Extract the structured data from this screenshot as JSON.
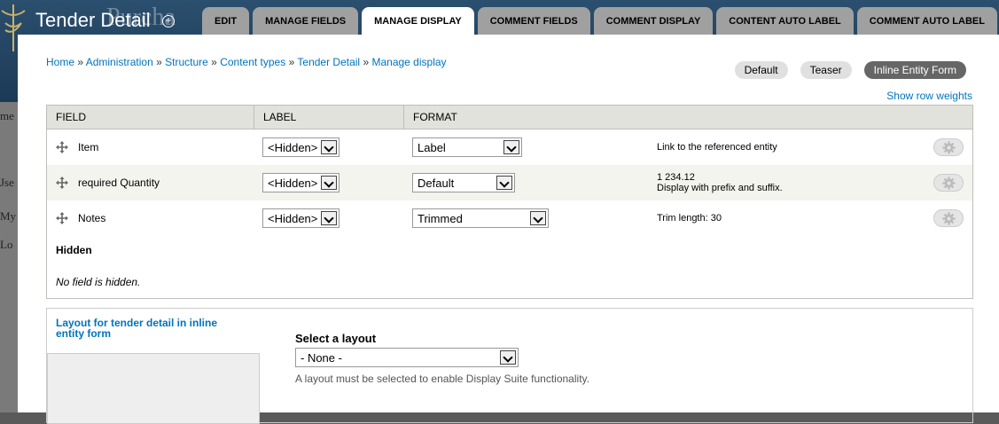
{
  "background": {
    "site_title_fragment": "Purcha",
    "left_texts": [
      "me",
      "Jse",
      "My",
      "Lo"
    ]
  },
  "overlay": {
    "title": "Tender Detail"
  },
  "tabs": [
    {
      "label": "EDIT"
    },
    {
      "label": "MANAGE FIELDS"
    },
    {
      "label": "MANAGE DISPLAY",
      "active": true
    },
    {
      "label": "COMMENT FIELDS"
    },
    {
      "label": "COMMENT DISPLAY"
    },
    {
      "label": "CONTENT AUTO LABEL"
    },
    {
      "label": "COMMENT AUTO LABEL"
    }
  ],
  "breadcrumb": {
    "items": [
      "Home",
      "Administration",
      "Structure",
      "Content types",
      "Tender Detail",
      "Manage display"
    ],
    "separator": "»"
  },
  "view_modes": [
    {
      "label": "Default"
    },
    {
      "label": "Teaser"
    },
    {
      "label": "Inline Entity Form",
      "active": true
    }
  ],
  "show_row_weights": "Show row weights",
  "table": {
    "headers": {
      "field": "FIELD",
      "label": "LABEL",
      "format": "FORMAT"
    },
    "rows": [
      {
        "name": "Item",
        "label": "<Hidden>",
        "format": "Label",
        "summary": [
          "Link to the referenced entity"
        ]
      },
      {
        "name": "required Quantity",
        "label": "<Hidden>",
        "format": "Default",
        "summary": [
          "1 234.12",
          "Display with prefix and suffix."
        ]
      },
      {
        "name": "Notes",
        "label": "<Hidden>",
        "format": "Trimmed",
        "summary": [
          "Trim length: 30"
        ]
      }
    ],
    "hidden_title": "Hidden",
    "no_hidden": "No field is hidden."
  },
  "layout": {
    "title": "Layout for tender detail in inline entity form",
    "select_label": "Select a layout",
    "select_value": "- None -",
    "description": "A layout must be selected to enable Display Suite functionality."
  },
  "colors": {
    "link": "#0074bd",
    "tab_inactive": "#a0a0a0",
    "view_mode_active": "#666666"
  }
}
